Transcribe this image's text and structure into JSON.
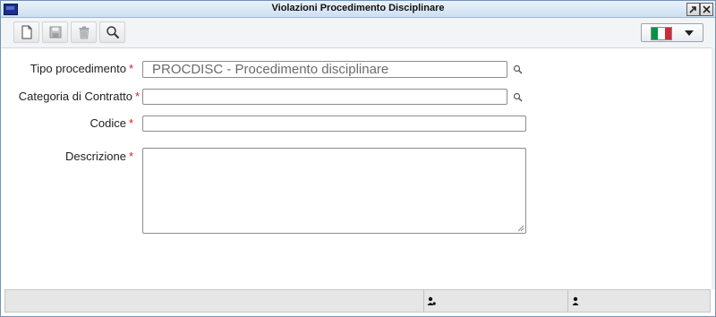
{
  "window": {
    "title": "Violazioni Procedimento Disciplinare",
    "controls": [
      "pin",
      "close"
    ]
  },
  "toolbar": {
    "buttons": [
      {
        "name": "new",
        "icon": "new-document-icon"
      },
      {
        "name": "save",
        "icon": "floppy-disk-icon"
      },
      {
        "name": "delete",
        "icon": "trash-icon"
      },
      {
        "name": "search",
        "icon": "magnifier-icon"
      }
    ],
    "language": {
      "selected": "it",
      "flag_colors": [
        "#009246",
        "#ffffff",
        "#ce2b37"
      ]
    }
  },
  "form": {
    "required_marker": "*",
    "tipo_procedimento": {
      "label": "Tipo procedimento",
      "value": "PROCDISC - Procedimento disciplinare"
    },
    "categoria_contratto": {
      "label": "Categoria di Contratto",
      "value": ""
    },
    "codice": {
      "label": "Codice",
      "value": ""
    },
    "descrizione": {
      "label": "Descrizione",
      "value": ""
    }
  },
  "statusbar": {
    "icons": [
      "user-info-icon",
      "user-icon"
    ]
  },
  "colors": {
    "titlebar": "#cddff1",
    "border": "#6f93b8",
    "required": "#d41f1f",
    "toolbar_bg": "#f2f4f6",
    "statusbar_bg": "#e6e6e6"
  }
}
